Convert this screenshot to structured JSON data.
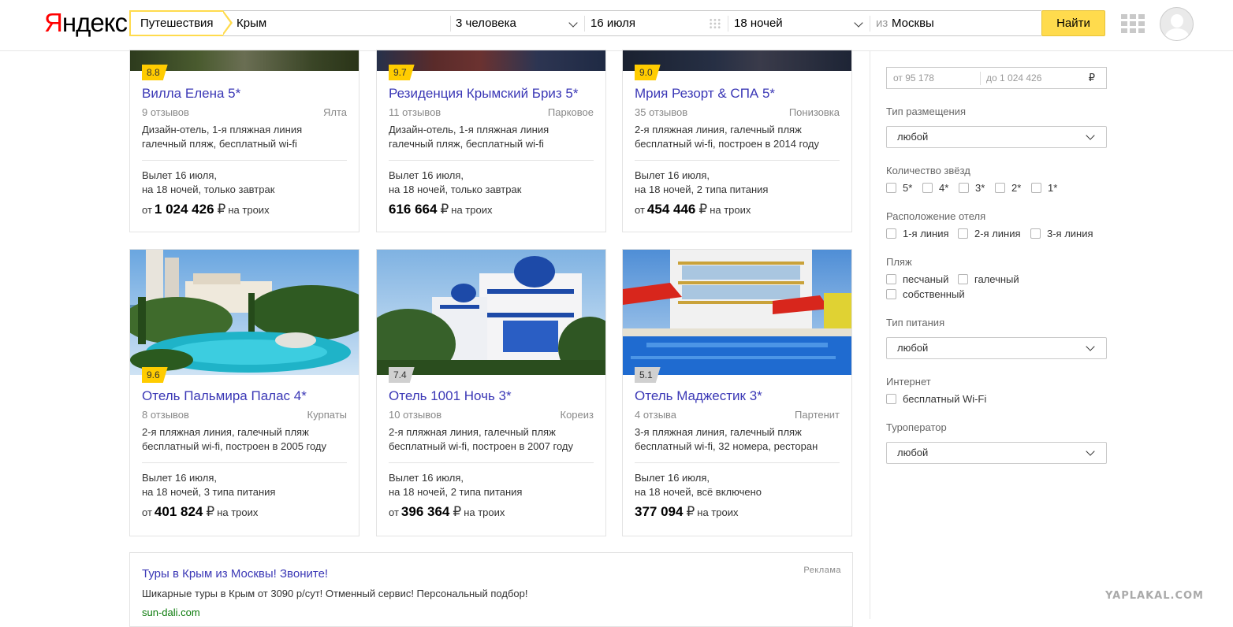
{
  "header": {
    "logo": "Яндекс",
    "service": "Путешествия",
    "destination": "Крым",
    "people": "3 человека",
    "date": "16 июля",
    "nights": "18 ночей",
    "from_prefix": "из",
    "from_city": "Москвы",
    "search_button": "Найти"
  },
  "cards_row1": [
    {
      "rating": "8.8",
      "rating_style": "y",
      "title": "Вилла Елена 5*",
      "reviews": "9 отзывов",
      "location": "Ялта",
      "desc1": "Дизайн-отель, 1-я пляжная линия",
      "desc2": "галечный пляж, бесплатный wi-fi",
      "flight1": "Вылет 16 июля,",
      "flight2": "на 18 ночей, только завтрак",
      "price_prefix": "от",
      "price": "1 024 426",
      "currency": "₽",
      "price_suffix": "на троих"
    },
    {
      "rating": "9.7",
      "rating_style": "y",
      "title": "Резиденция Крымский Бриз 5*",
      "reviews": "11 отзывов",
      "location": "Парковое",
      "desc1": "Дизайн-отель, 1-я пляжная линия",
      "desc2": "галечный пляж, бесплатный wi-fi",
      "flight1": "Вылет 16 июля,",
      "flight2": "на 18 ночей, только завтрак",
      "price_prefix": "",
      "price": "616 664",
      "currency": "₽",
      "price_suffix": "на троих"
    },
    {
      "rating": "9.0",
      "rating_style": "y",
      "title": "Мрия Резорт & СПА 5*",
      "reviews": "35 отзывов",
      "location": "Понизовка",
      "desc1": "2-я пляжная линия, галечный пляж",
      "desc2": "бесплатный wi-fi, построен в 2014 году",
      "flight1": "Вылет 16 июля,",
      "flight2": "на 18 ночей, 2 типа питания",
      "price_prefix": "от",
      "price": "454 446",
      "currency": "₽",
      "price_suffix": "на троих"
    }
  ],
  "cards_row2": [
    {
      "rating": "9.6",
      "rating_style": "y",
      "title": "Отель Пальмира Палас 4*",
      "reviews": "8 отзывов",
      "location": "Курпаты",
      "desc1": "2-я пляжная линия, галечный пляж",
      "desc2": "бесплатный wi-fi, построен в 2005 году",
      "flight1": "Вылет 16 июля,",
      "flight2": "на 18 ночей, 3 типа питания",
      "price_prefix": "от",
      "price": "401 824",
      "currency": "₽",
      "price_suffix": "на троих"
    },
    {
      "rating": "7.4",
      "rating_style": "g",
      "title": "Отель 1001 Ночь 3*",
      "reviews": "10 отзывов",
      "location": "Кореиз",
      "desc1": "2-я пляжная линия, галечный пляж",
      "desc2": "бесплатный wi-fi, построен в 2007 году",
      "flight1": "Вылет 16 июля,",
      "flight2": "на 18 ночей, 2 типа питания",
      "price_prefix": "от",
      "price": "396 364",
      "currency": "₽",
      "price_suffix": "на троих"
    },
    {
      "rating": "5.1",
      "rating_style": "g",
      "title": "Отель Маджестик 3*",
      "reviews": "4 отзыва",
      "location": "Партенит",
      "desc1": "3-я пляжная линия, галечный пляж",
      "desc2": "бесплатный wi-fi, 32 номера, ресторан",
      "flight1": "Вылет 16 июля,",
      "flight2": "на 18 ночей, всё включено",
      "price_prefix": "",
      "price": "377 094",
      "currency": "₽",
      "price_suffix": "на троих"
    }
  ],
  "ad": {
    "title": "Туры в Крым из Москвы! Звоните!",
    "label": "Реклама",
    "text": "Шикарные туры в Крым от 3090 р/сут! Отменный сервис! Персональный подбор!",
    "url": "sun-dali.com"
  },
  "filters": {
    "price_from": "от 95 178",
    "price_to": "до 1 024 426",
    "price_currency": "₽",
    "accommodation_label": "Тип размещения",
    "accommodation_value": "любой",
    "stars_label": "Количество звёзд",
    "stars": [
      "5*",
      "4*",
      "3*",
      "2*",
      "1*"
    ],
    "location_label": "Расположение отеля",
    "locations": [
      "1-я линия",
      "2-я линия",
      "3-я линия"
    ],
    "beach_label": "Пляж",
    "beaches": [
      "песчаный",
      "галечный",
      "собственный"
    ],
    "meal_label": "Тип питания",
    "meal_value": "любой",
    "internet_label": "Интернет",
    "internet_option": "бесплатный Wi-Fi",
    "operator_label": "Туроператор",
    "operator_value": "любой"
  },
  "watermark": "YAPLAKAL.COM",
  "colors": {
    "accent": "#ffdb4d",
    "link": "#3b38b6",
    "ad_url": "#0a7a0a"
  }
}
